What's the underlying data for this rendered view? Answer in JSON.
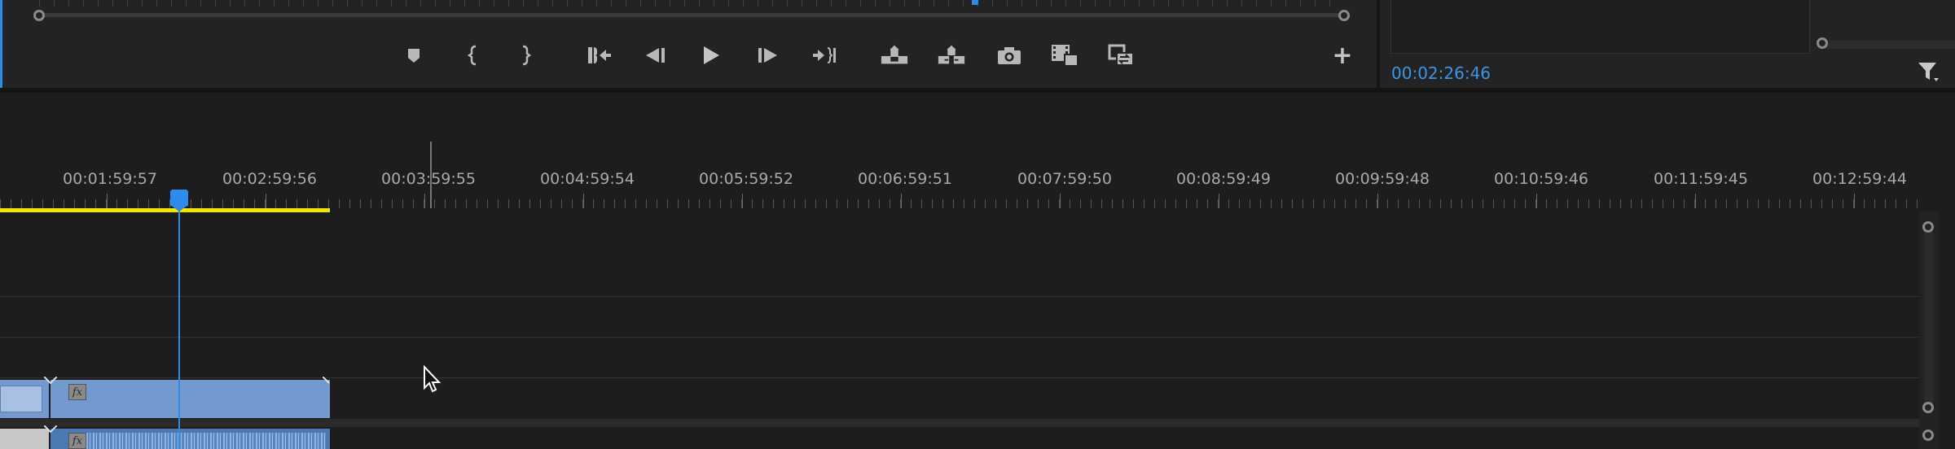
{
  "program_monitor": {
    "transport_controls": [
      {
        "name": "add-marker-button",
        "icon": "marker-icon"
      },
      {
        "name": "mark-in-button",
        "icon": "mark-in-icon"
      },
      {
        "name": "mark-out-button",
        "icon": "mark-out-icon"
      },
      {
        "name": "go-to-in-button",
        "icon": "go-to-in-icon"
      },
      {
        "name": "step-back-button",
        "icon": "step-back-icon"
      },
      {
        "name": "play-button",
        "icon": "play-icon"
      },
      {
        "name": "step-forward-button",
        "icon": "step-forward-icon"
      },
      {
        "name": "go-to-out-button",
        "icon": "go-to-out-icon"
      },
      {
        "name": "lift-button",
        "icon": "lift-icon"
      },
      {
        "name": "extract-button",
        "icon": "extract-icon"
      },
      {
        "name": "export-frame-button",
        "icon": "camera-icon"
      },
      {
        "name": "insert-button",
        "icon": "insert-icon"
      },
      {
        "name": "overwrite-button",
        "icon": "overwrite-icon"
      }
    ],
    "add_button_label": "+"
  },
  "right_panel": {
    "timecode": "00:02:26:46",
    "filter_icon": "filter-icon"
  },
  "timeline": {
    "ruler_labels": [
      "00:01:59:57",
      "00:02:59:56",
      "00:03:59:55",
      "00:04:59:54",
      "00:05:59:52",
      "00:06:59:51",
      "00:07:59:50",
      "00:08:59:49",
      "00:09:59:48",
      "00:10:59:46",
      "00:11:59:45",
      "00:12:59:44"
    ],
    "video_clip_fx": "fx",
    "audio_clip_fx": "fx",
    "colors": {
      "playhead": "#2d8ceb",
      "work_area": "#f5e400",
      "video_clip": "#7399cf",
      "audio_clip": "#4c79b4"
    }
  }
}
